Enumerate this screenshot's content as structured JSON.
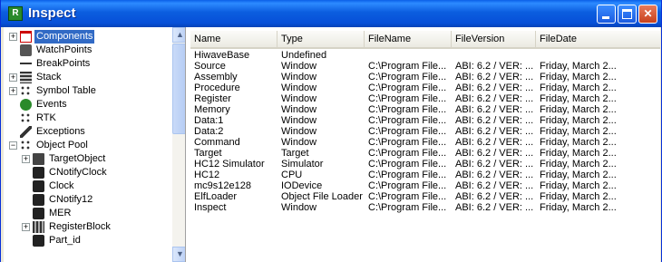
{
  "window": {
    "title": "Inspect"
  },
  "tree": {
    "items": [
      {
        "label": "Components",
        "icon": "components-icon",
        "expander": "+",
        "selected": true
      },
      {
        "label": "WatchPoints",
        "icon": "watchpoints-icon"
      },
      {
        "label": "BreakPoints",
        "icon": "breakpoints-icon"
      },
      {
        "label": "Stack",
        "icon": "stack-icon",
        "expander": "+"
      },
      {
        "label": "Symbol Table",
        "icon": "symbol-table-icon",
        "expander": "+"
      },
      {
        "label": "Events",
        "icon": "events-icon"
      },
      {
        "label": "RTK",
        "icon": "rtk-icon"
      },
      {
        "label": "Exceptions",
        "icon": "exceptions-icon"
      },
      {
        "label": "Object Pool",
        "icon": "object-pool-icon",
        "expander": "−"
      },
      {
        "label": "TargetObject",
        "icon": "target-object-icon",
        "expander": "+"
      },
      {
        "label": "CNotifyClock",
        "icon": "object-icon"
      },
      {
        "label": "Clock",
        "icon": "object-icon"
      },
      {
        "label": "CNotify12",
        "icon": "object-icon"
      },
      {
        "label": "MER",
        "icon": "object-icon"
      },
      {
        "label": "RegisterBlock",
        "icon": "register-block-icon",
        "expander": "+"
      },
      {
        "label": "Part_id",
        "icon": "object-icon"
      }
    ]
  },
  "list": {
    "columns": [
      "Name",
      "Type",
      "FileName",
      "FileVersion",
      "FileDate"
    ],
    "rows": [
      [
        "HiwaveBase",
        "Undefined",
        "",
        "",
        ""
      ],
      [
        "Source",
        "Window",
        "C:\\Program File...",
        "ABI: 6.2 / VER: ...",
        "Friday, March 2..."
      ],
      [
        "Assembly",
        "Window",
        "C:\\Program File...",
        "ABI: 6.2 / VER: ...",
        "Friday, March 2..."
      ],
      [
        "Procedure",
        "Window",
        "C:\\Program File...",
        "ABI: 6.2 / VER: ...",
        "Friday, March 2..."
      ],
      [
        "Register",
        "Window",
        "C:\\Program File...",
        "ABI: 6.2 / VER: ...",
        "Friday, March 2..."
      ],
      [
        "Memory",
        "Window",
        "C:\\Program File...",
        "ABI: 6.2 / VER: ...",
        "Friday, March 2..."
      ],
      [
        "Data:1",
        "Window",
        "C:\\Program File...",
        "ABI: 6.2 / VER: ...",
        "Friday, March 2..."
      ],
      [
        "Data:2",
        "Window",
        "C:\\Program File...",
        "ABI: 6.2 / VER: ...",
        "Friday, March 2..."
      ],
      [
        "Command",
        "Window",
        "C:\\Program File...",
        "ABI: 6.2 / VER: ...",
        "Friday, March 2..."
      ],
      [
        "Target",
        "Target",
        "C:\\Program File...",
        "ABI: 6.2 / VER: ...",
        "Friday, March 2..."
      ],
      [
        "HC12 Simulator",
        "Simulator",
        "C:\\Program File...",
        "ABI: 6.2 / VER: ...",
        "Friday, March 2..."
      ],
      [
        "HC12",
        "CPU",
        "C:\\Program File...",
        "ABI: 6.2 / VER: ...",
        "Friday, March 2..."
      ],
      [
        "mc9s12e128",
        "IODevice",
        "C:\\Program File...",
        "ABI: 6.2 / VER: ...",
        "Friday, March 2..."
      ],
      [
        "ElfLoader",
        "Object File Loader",
        "C:\\Program File...",
        "ABI: 6.2 / VER: ...",
        "Friday, March 2..."
      ],
      [
        "Inspect",
        "Window",
        "C:\\Program File...",
        "ABI: 6.2 / VER: ...",
        "Friday, March 2..."
      ]
    ]
  },
  "colors": {
    "titlebar": "#0b5ddf",
    "selection": "#316ac5",
    "close_button": "#c8411c"
  }
}
